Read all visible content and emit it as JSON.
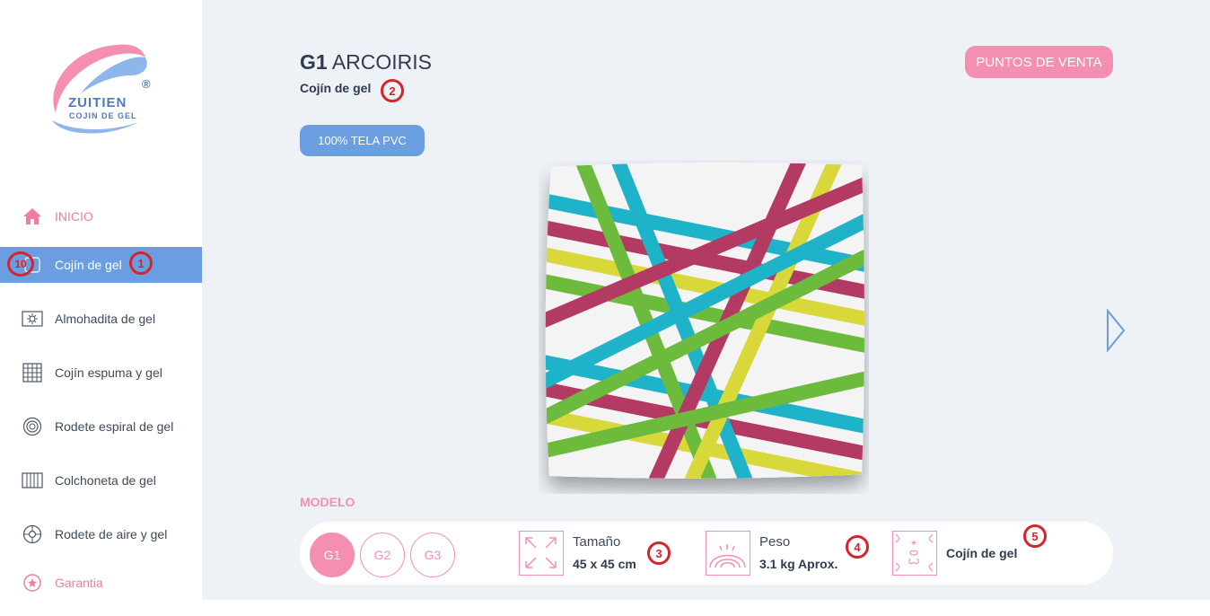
{
  "logo": {
    "name": "ZUITIEN",
    "tagline": "COJIN DE GEL",
    "registered": "®"
  },
  "sidebar": {
    "items": [
      {
        "label": "INICIO",
        "icon": "home-icon"
      },
      {
        "label": "Cojín de gel",
        "icon": "cushion-icon"
      },
      {
        "label": "Almohadita de gel",
        "icon": "pillow-icon"
      },
      {
        "label": "Cojín espuma y gel",
        "icon": "grid-cushion-icon"
      },
      {
        "label": "Rodete espiral de gel",
        "icon": "spiral-ring-icon"
      },
      {
        "label": "Colchoneta de gel",
        "icon": "mattress-icon"
      },
      {
        "label": "Rodete de aire y gel",
        "icon": "air-ring-icon"
      },
      {
        "label": "Garantia",
        "icon": "warranty-icon"
      }
    ]
  },
  "badges": [
    "1",
    "2",
    "3",
    "4",
    "5",
    "10"
  ],
  "product": {
    "code": "G1",
    "name": "ARCOIRIS",
    "subtitle": "Cojín de gel",
    "material": "100% TELA PVC",
    "image": "rainbow-gel-cushion"
  },
  "header": {
    "sales_button": "PUNTOS DE VENTA"
  },
  "model": {
    "heading": "MODELO",
    "options": [
      "G1",
      "G2",
      "G3"
    ],
    "selected": "G1"
  },
  "specs": {
    "size_label": "Tamaño",
    "size_value": "45 x 45 cm",
    "weight_label": "Peso",
    "weight_value": "3.1 kg Aprox.",
    "type_value": "Cojín de gel"
  },
  "colors": {
    "accent_pink": "#f48fb1",
    "accent_blue": "#6a9ee1",
    "badge_red": "#d8232a"
  }
}
